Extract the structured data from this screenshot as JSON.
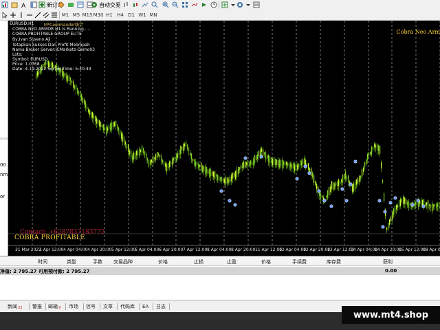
{
  "toolbar": {
    "new_order_label": "新订单",
    "auto_trading_label": "自动交易",
    "timeframes": [
      "M1",
      "M5",
      "M15",
      "M30",
      "H1",
      "H4",
      "D1",
      "W1",
      "MN"
    ]
  },
  "left_panel": {
    "fragments": [
      "00",
      "nm",
      "or"
    ]
  },
  "chart": {
    "symbol_tag": "EURUSD,H1",
    "commander_tag": "M*Commander统计",
    "info_lines": [
      "COBRA NEO ARMOR H1 Is Running.....",
      "COBRA PROFITABLE GROUP ELITE",
      "By,Ivan Suseno Aji",
      "Tetapkan Sukses Dan Profit Melimpah",
      "Nama Broker Server:ICMarkets-Demo03",
      "Lots:",
      "Symbol: EURUSD",
      "Price:  1.0768",
      "Date: 4-19-2022 Server Time: 5:40:49"
    ],
    "cobra_title": "Cobra Neo Arm",
    "contact": "Contact: +6287837183772",
    "cobra_profitable": "COBRA PROFITABLE",
    "x_labels": [
      "31 Mar 2022",
      "1 Apr 12:00",
      "4 Apr 04:00",
      "4 Apr 20:00",
      "5 Apr 12:00",
      "6 Apr 04:00",
      "6 Apr 20:00",
      "7 Apr 12:00",
      "8 Apr 04:00",
      "8 Apr 20:00",
      "11 Apr 12:00",
      "12 Apr 04:00",
      "12 Apr 20:00",
      "13 Apr 12:00",
      "14 Apr 04:00",
      "14 Apr 20:00",
      "15 Apr 12:00",
      "18 Apr 04:00"
    ],
    "colors": {
      "background": "#000000",
      "candle": "#7ed321",
      "candle_bright": "#c8ff30",
      "signal": "#6a9cff",
      "grid": "#e8e8e8"
    }
  },
  "terminal": {
    "columns": [
      "时间",
      "类型",
      "手数",
      "交易品种",
      "价格",
      "止损",
      "止盈",
      "价格",
      "手续费",
      "库存费",
      "获利"
    ],
    "balance_text": "净值: 2 795.27   可用预付款: 2 795.27",
    "profit": "0.00"
  },
  "tabs": [
    {
      "label": "新闻",
      "count": "33"
    },
    {
      "label": "警报",
      "count": ""
    },
    {
      "label": "邮箱",
      "count": "9"
    },
    {
      "label": "市场",
      "count": ""
    },
    {
      "label": "信号",
      "count": ""
    },
    {
      "label": "文章",
      "count": ""
    },
    {
      "label": "代码库",
      "count": ""
    },
    {
      "label": "EA",
      "count": ""
    },
    {
      "label": "日志",
      "count": ""
    }
  ],
  "watermark": "www.mt4.shop"
}
